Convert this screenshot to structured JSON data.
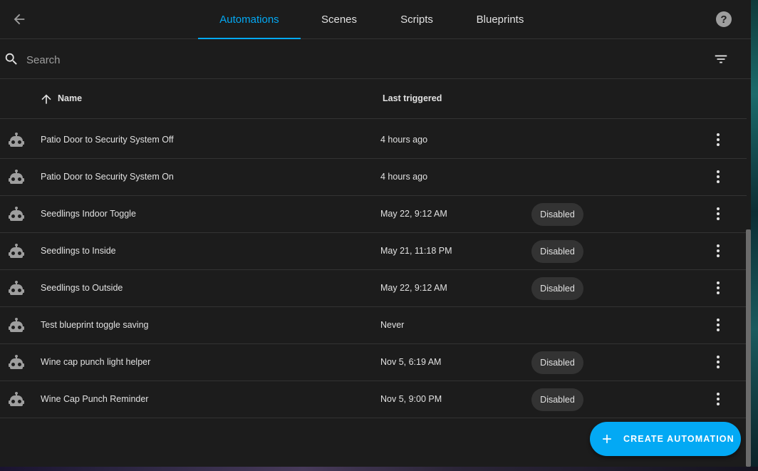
{
  "tabs": [
    {
      "label": "Automations",
      "active": true
    },
    {
      "label": "Scenes",
      "active": false
    },
    {
      "label": "Scripts",
      "active": false
    },
    {
      "label": "Blueprints",
      "active": false
    }
  ],
  "search": {
    "placeholder": "Search",
    "value": ""
  },
  "table": {
    "columns": {
      "name": "Name",
      "last_triggered": "Last triggered"
    },
    "sort": "ascending",
    "rows": [
      {
        "name": "Patio Door to Security System Off",
        "last_triggered": "4 hours ago",
        "status": ""
      },
      {
        "name": "Patio Door to Security System On",
        "last_triggered": "4 hours ago",
        "status": ""
      },
      {
        "name": "Seedlings Indoor Toggle",
        "last_triggered": "May 22, 9:12 AM",
        "status": "Disabled"
      },
      {
        "name": "Seedlings to Inside",
        "last_triggered": "May 21, 11:18 PM",
        "status": "Disabled"
      },
      {
        "name": "Seedlings to Outside",
        "last_triggered": "May 22, 9:12 AM",
        "status": "Disabled"
      },
      {
        "name": "Test blueprint toggle saving",
        "last_triggered": "Never",
        "status": ""
      },
      {
        "name": "Wine cap punch light helper",
        "last_triggered": "Nov 5, 6:19 AM",
        "status": "Disabled"
      },
      {
        "name": "Wine Cap Punch Reminder",
        "last_triggered": "Nov 5, 9:00 PM",
        "status": "Disabled"
      }
    ]
  },
  "fab": {
    "label": "CREATE AUTOMATION"
  },
  "icons": {
    "back": "arrow-left-icon",
    "help": "help-circle-icon",
    "search": "magnify-icon",
    "filter": "filter-variant-icon",
    "sort": "arrow-up-icon",
    "row": "robot-icon",
    "more": "dots-vertical-icon",
    "fab": "plus-icon"
  },
  "colors": {
    "accent": "#03a9f4",
    "panel_bg": "#1c1c1c",
    "badge_bg": "#333333",
    "text": "#e1e1e1"
  }
}
